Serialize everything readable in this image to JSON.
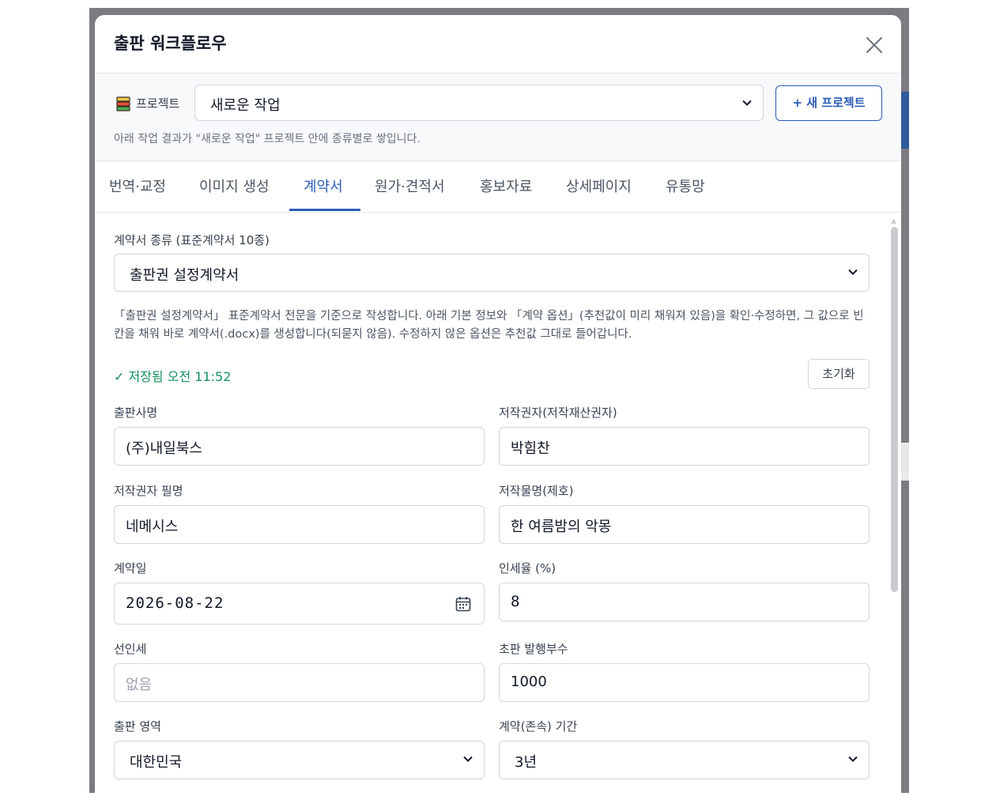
{
  "modal": {
    "title": "출판 워크플로우"
  },
  "project": {
    "label": "프로젝트",
    "selected": "새로운 작업",
    "new_button": "+ 새 프로젝트",
    "note": "아래 작업 결과가 \"새로운 작업\" 프로젝트 안에 종류별로 쌓입니다."
  },
  "tabs": [
    {
      "label": "번역·교정"
    },
    {
      "label": "이미지 생성"
    },
    {
      "label": "계약서",
      "active": true
    },
    {
      "label": "원가·견적서"
    },
    {
      "label": "홍보자료"
    },
    {
      "label": "상세페이지"
    },
    {
      "label": "유통망"
    }
  ],
  "contract": {
    "type_label": "계약서 종류 (표준계약서 10종)",
    "type_value": "출판권 설정계약서",
    "description": "「출판권 설정계약서」 표준계약서 전문을 기준으로 작성합니다. 아래 기본 정보와 「계약 옵션」(추천값이 미리 채워져 있음)을 확인·수정하면, 그 값으로 빈칸을 채워 바로 계약서(.docx)를 생성합니다(되묻지 않음). 수정하지 않은 옵션은 추천값 그대로 들어갑니다.",
    "saved_status": "✓ 저장됨 오전 11:52",
    "reset_button": "초기화",
    "fields": {
      "publisher": {
        "label": "출판사명",
        "value": "(주)내일북스"
      },
      "author": {
        "label": "저작권자(저작재산권자)",
        "value": "박힘찬"
      },
      "pen_name": {
        "label": "저작권자 필명",
        "value": "네메시스"
      },
      "work_title": {
        "label": "저작물명(제호)",
        "value": "한 여름밤의 악몽"
      },
      "contract_date": {
        "label": "계약일",
        "value": "2026-08-22"
      },
      "royalty": {
        "label": "인세율 (%)",
        "value": "8"
      },
      "advance": {
        "label": "선인세",
        "placeholder": "없음"
      },
      "first_print": {
        "label": "초판 발행부수",
        "value": "1000"
      },
      "territory": {
        "label": "출판 영역",
        "value": "대한민국"
      },
      "term": {
        "label": "계약(존속) 기간",
        "value": "3년"
      }
    }
  },
  "colors": {
    "accent": "#2c5cb8",
    "saved": "#15915a",
    "backdrop": "#7a7c80"
  },
  "icons": [
    "book-stack-icon",
    "close-icon",
    "chevron-down-icon",
    "calendar-icon",
    "checkmark-icon"
  ]
}
